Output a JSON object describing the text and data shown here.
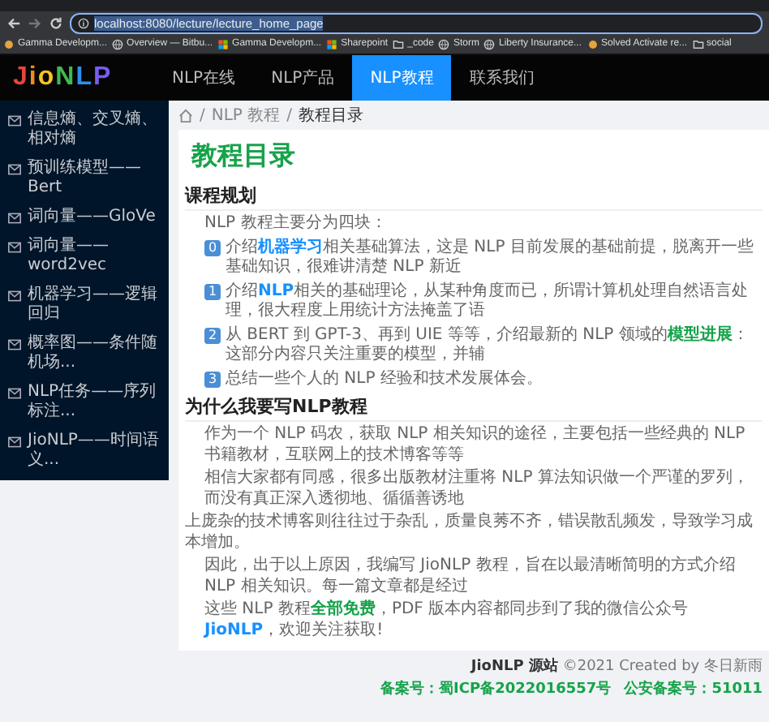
{
  "browser": {
    "address": "localhost:8080/lecture/lecture_home_page",
    "address_selected": true,
    "bookmarks": [
      {
        "label": "Gamma Developm...",
        "kind": "app"
      },
      {
        "label": "Overview — Bitbu...",
        "kind": "globe"
      },
      {
        "label": "Gamma Developm...",
        "kind": "grid"
      },
      {
        "label": "Sharepoint",
        "kind": "grid"
      },
      {
        "label": "_code",
        "kind": "folder"
      },
      {
        "label": "Storm",
        "kind": "globe"
      },
      {
        "label": "Liberty Insurance...",
        "kind": "globe"
      },
      {
        "label": "Solved Activate re...",
        "kind": "app"
      },
      {
        "label": "social",
        "kind": "folder"
      }
    ]
  },
  "header": {
    "logo": "JioNLP",
    "nav": [
      {
        "label": "NLP在线",
        "selected": false
      },
      {
        "label": "NLP产品",
        "selected": false
      },
      {
        "label": "NLP教程",
        "selected": true
      },
      {
        "label": "联系我们",
        "selected": false
      }
    ]
  },
  "sidebar": {
    "items": [
      "信息熵、交叉熵、相对熵",
      "预训练模型——Bert",
      "词向量——GloVe",
      "词向量——word2vec",
      "机器学习——逻辑回归",
      "概率图——条件随机场...",
      "NLP任务——序列标注...",
      "JioNLP——时间语义..."
    ]
  },
  "breadcrumb": [
    "NLP 教程",
    "教程目录"
  ],
  "breadcrumb_separator": "/",
  "title": "教程目录",
  "sections": [
    {
      "heading": "课程规划",
      "blocks": [
        {
          "kind": "text",
          "parts": [
            {
              "kind": "plain",
              "text": "NLP 教程主要分为四块："
            }
          ]
        },
        {
          "kind": "numbered",
          "number": "0",
          "parts": [
            {
              "kind": "plain",
              "text": "介绍"
            },
            {
              "kind": "link",
              "text": "机器学习"
            },
            {
              "kind": "plain",
              "text": "相关基础算法，这是 NLP 目前发展的基础前提，脱离开一些基础知识，很难讲清楚 NLP 新近"
            }
          ]
        },
        {
          "kind": "numbered",
          "number": "1",
          "parts": [
            {
              "kind": "plain",
              "text": "介绍"
            },
            {
              "kind": "link",
              "text": "NLP"
            },
            {
              "kind": "plain",
              "text": "相关的基础理论，从某种角度而已，所谓计算机处理自然语言处理，很大程度上用统计方法掩盖了语"
            }
          ]
        },
        {
          "kind": "numbered",
          "number": "2",
          "parts": [
            {
              "kind": "plain",
              "text": "从 BERT 到 GPT-3、再到 UIE 等等，介绍最新的 NLP 领域的"
            },
            {
              "kind": "highlight",
              "text": "模型进展"
            },
            {
              "kind": "plain",
              "text": "：这部分内容只关注重要的模型，并辅"
            }
          ]
        },
        {
          "kind": "numbered",
          "number": "3",
          "parts": [
            {
              "kind": "plain",
              "text": "总结一些个人的 NLP 经验和技术发展体会。"
            }
          ]
        }
      ]
    },
    {
      "heading": "为什么我要写NLP教程",
      "blocks": [
        {
          "kind": "text",
          "parts": [
            {
              "kind": "plain",
              "text": "作为一个 NLP 码农，获取 NLP 相关知识的途径，主要包括一些经典的 NLP 书籍教材，互联网上的技术博客等等"
            }
          ]
        },
        {
          "kind": "text",
          "parts": [
            {
              "kind": "plain",
              "text": "相信大家都有同感，很多出版教材注重将 NLP 算法知识做一个严谨的罗列，而没有真正深入透彻地、循循善诱地"
            }
          ]
        },
        {
          "kind": "continuation",
          "parts": [
            {
              "kind": "plain",
              "text": "上庞杂的技术博客则往往过于杂乱，质量良莠不齐，错误散乱频发，导致学习成本增加。"
            }
          ]
        },
        {
          "kind": "text",
          "parts": [
            {
              "kind": "plain",
              "text": "因此，出于以上原因，我编写 JioNLP 教程，旨在以最清晰简明的方式介绍 NLP 相关知识。每一篇文章都是经过"
            }
          ]
        },
        {
          "kind": "text",
          "parts": [
            {
              "kind": "plain",
              "text": "这些 NLP 教程"
            },
            {
              "kind": "highlight",
              "text": "全部免费"
            },
            {
              "kind": "plain",
              "text": "，PDF 版本内容都同步到了我的微信公众号 "
            },
            {
              "kind": "link",
              "text": "JioNLP"
            },
            {
              "kind": "plain",
              "text": "，欢迎关注获取!"
            }
          ]
        }
      ]
    }
  ],
  "footer": {
    "site": "JioNLP 源站",
    "credit": "©2021 Created by 冬日新雨",
    "records": [
      "备案号：蜀ICP备2022016557号",
      "公安备案号：51011"
    ]
  }
}
